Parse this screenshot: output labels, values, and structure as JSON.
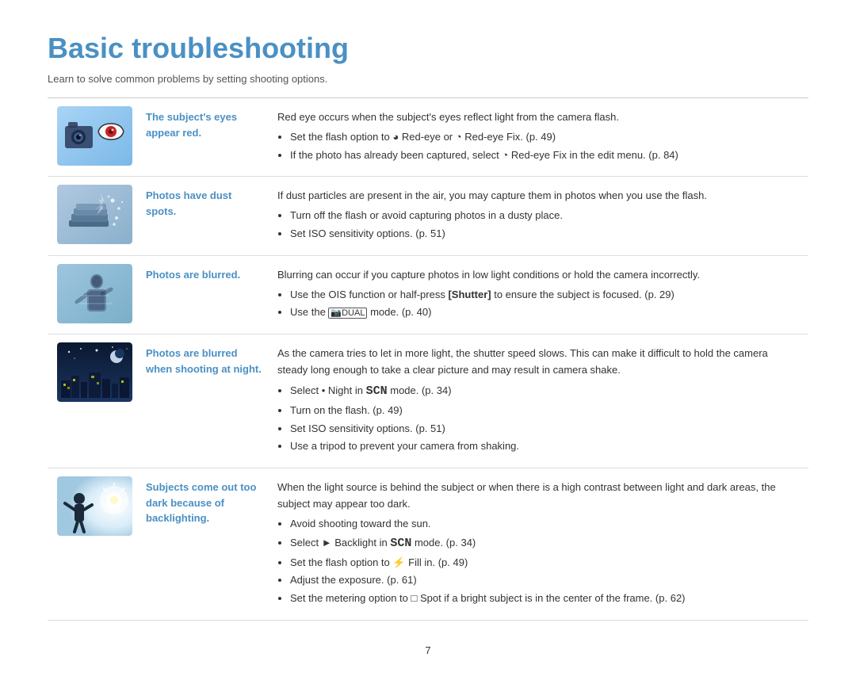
{
  "page": {
    "title": "Basic troubleshooting",
    "subtitle": "Learn to solve common problems by setting shooting options.",
    "page_number": "7"
  },
  "rows": [
    {
      "id": "red-eye",
      "label": "The subject's eyes appear red.",
      "image_alt": "red eye illustration",
      "image_class": "img-redeye",
      "content_intro": "Red eye occurs when the subject's eyes reflect light from the camera flash.",
      "bullets": [
        "Set the flash option to ◕ Red-eye or ◔ Red-eye Fix. (p. 49)",
        "If the photo has already been captured, select ◔ Red-eye Fix in the edit menu. (p. 84)"
      ]
    },
    {
      "id": "dust",
      "label": "Photos have dust spots.",
      "image_alt": "dust spots illustration",
      "image_class": "img-dust",
      "content_intro": "If dust particles are present in the air, you may capture them in photos when you use the flash.",
      "bullets": [
        "Turn off the flash or avoid capturing photos in a dusty place.",
        "Set ISO sensitivity options. (p. 51)"
      ]
    },
    {
      "id": "blurred",
      "label": "Photos are blurred.",
      "image_alt": "blurred photo illustration",
      "image_class": "img-blur",
      "content_intro": "Blurring can occur if you capture photos in low light conditions or hold the camera incorrectly.",
      "bullets": [
        "Use the OIS function or half-press [Shutter] to ensure the subject is focused. (p. 29)",
        "Use the ®DUAL mode. (p. 40)"
      ]
    },
    {
      "id": "night",
      "label": "Photos are blurred when shooting at night.",
      "image_alt": "night shooting illustration",
      "image_class": "img-night",
      "content_intro": "As the camera tries to let in more light, the shutter speed slows. This can make it difficult to hold the camera steady long enough to take a clear picture and may result in camera shake.",
      "bullets": [
        "Select • Night in SCN mode. (p. 34)",
        "Turn on the flash. (p. 49)",
        "Set ISO sensitivity options. (p. 51)",
        "Use a tripod to prevent your camera from shaking."
      ]
    },
    {
      "id": "backlight",
      "label": "Subjects come out too dark because of backlighting.",
      "image_alt": "backlighting illustration",
      "image_class": "img-backlight",
      "content_intro": "When the light source is behind the subject or when there is a high contrast between light and dark areas, the subject may appear too dark.",
      "bullets": [
        "Avoid shooting toward the sun.",
        "Select ► Backlight in SCN mode. (p. 34)",
        "Set the flash option to ⚡ Fill in. (p. 49)",
        "Adjust the exposure. (p. 61)",
        "Set the metering option to □ Spot if a bright subject is in the center of the frame. (p. 62)"
      ]
    }
  ]
}
